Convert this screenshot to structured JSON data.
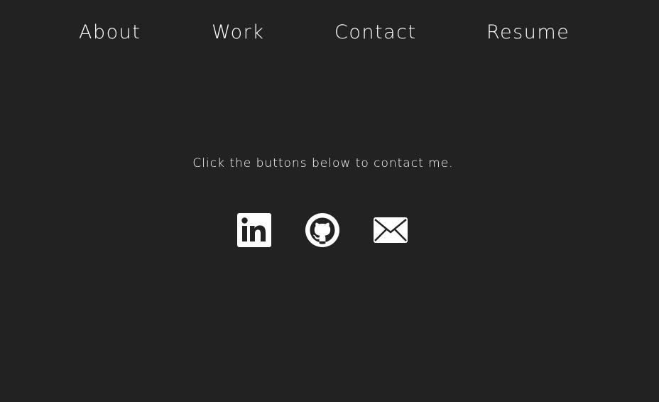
{
  "nav": {
    "items": [
      {
        "label": "About"
      },
      {
        "label": "Work"
      },
      {
        "label": "Contact"
      },
      {
        "label": "Resume"
      }
    ]
  },
  "contact": {
    "prompt": "Click the buttons below to contact me.",
    "links": [
      {
        "icon": "linkedin-icon"
      },
      {
        "icon": "github-icon"
      },
      {
        "icon": "email-icon"
      }
    ]
  },
  "colors": {
    "background": "#222222",
    "text": "#ffffff",
    "icon": "#ffffff"
  }
}
